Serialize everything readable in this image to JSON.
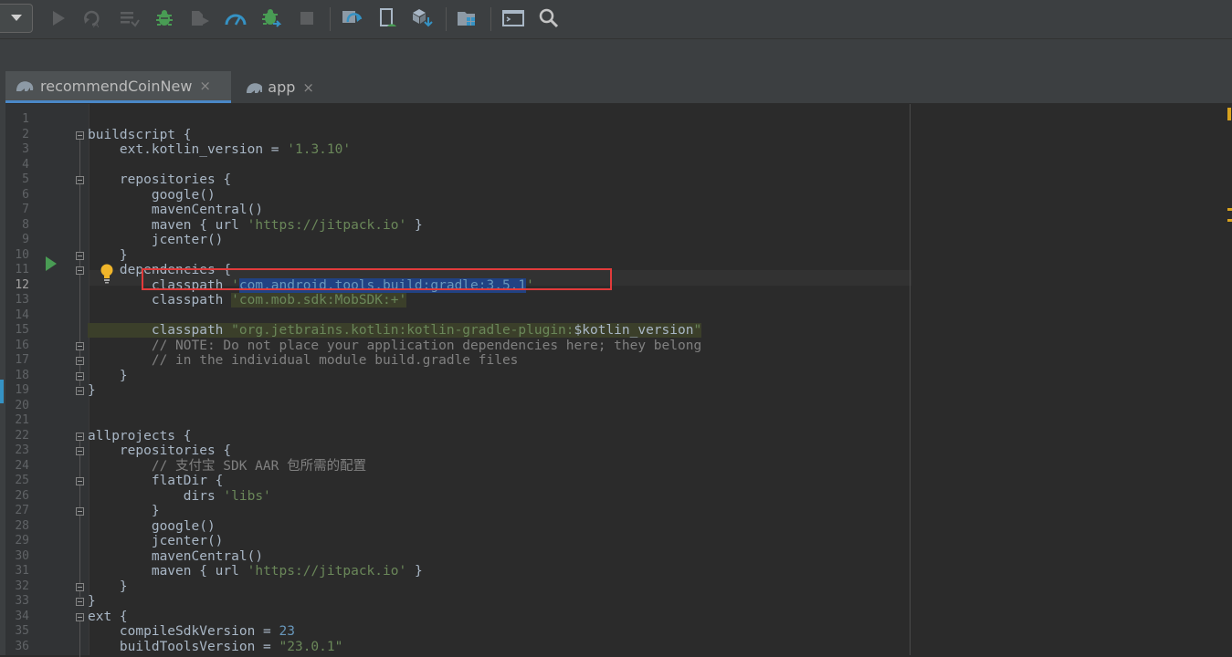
{
  "toolbar": {
    "icons": [
      "config-dropdown-icon",
      "run-icon",
      "apply-changes-icon",
      "coverage-icon",
      "debug-icon",
      "attach-debugger-icon",
      "profile-icon",
      "debug-bug-icon",
      "stop-icon",
      "sync-gradle-icon",
      "avd-manager-icon",
      "sdk-manager-icon",
      "project-structure-icon",
      "terminal-icon",
      "search-icon"
    ]
  },
  "tabs": [
    {
      "label": "recommendCoinNew",
      "active": true
    },
    {
      "label": "app",
      "active": false
    }
  ],
  "tab_close_glyph": "×",
  "editor": {
    "line_numbers": [
      "1",
      "2",
      "3",
      "4",
      "5",
      "6",
      "7",
      "8",
      "9",
      "10",
      "11",
      "12",
      "13",
      "14",
      "15",
      "16",
      "17",
      "18",
      "19",
      "20",
      "21",
      "22",
      "23",
      "24",
      "25",
      "26",
      "27",
      "28",
      "29",
      "30",
      "31",
      "32",
      "33",
      "34",
      "35",
      "36"
    ],
    "lines": [
      {
        "parts": []
      },
      {
        "parts": [
          {
            "t": "buildscript {",
            "c": "p"
          }
        ]
      },
      {
        "parts": [
          {
            "t": "    ext.kotlin_version = ",
            "c": "p"
          },
          {
            "t": "'1.3.10'",
            "c": "s"
          }
        ]
      },
      {
        "parts": []
      },
      {
        "parts": [
          {
            "t": "    repositories {",
            "c": "p"
          }
        ]
      },
      {
        "parts": [
          {
            "t": "        google()",
            "c": "p"
          }
        ]
      },
      {
        "parts": [
          {
            "t": "        mavenCentral()",
            "c": "p"
          }
        ]
      },
      {
        "parts": [
          {
            "t": "        maven { url ",
            "c": "p"
          },
          {
            "t": "'https://jitpack.io'",
            "c": "s"
          },
          {
            "t": " }",
            "c": "p"
          }
        ]
      },
      {
        "parts": [
          {
            "t": "        jcenter()",
            "c": "p"
          }
        ]
      },
      {
        "parts": [
          {
            "t": "    }",
            "c": "p"
          }
        ]
      },
      {
        "parts": [
          {
            "t": "    dependencies {",
            "c": "p"
          }
        ]
      },
      {
        "parts": [
          {
            "t": "        classpath ",
            "c": "p"
          },
          {
            "t": "'",
            "c": "s"
          },
          {
            "t": "com.android.tools.build:gradle:3.5.1",
            "c": "sel"
          },
          {
            "t": "'",
            "c": "s"
          }
        ]
      },
      {
        "parts": [
          {
            "t": "        classpath ",
            "c": "p"
          },
          {
            "t": "'com.mob.sdk:MobSDK:+'",
            "c": "sh"
          }
        ]
      },
      {
        "parts": []
      },
      {
        "parts": [
          {
            "t": "        classpath ",
            "c": "ph"
          },
          {
            "t": "\"org.jetbrains.kotlin:kotlin-gradle-plugin:",
            "c": "sh"
          },
          {
            "t": "$kotlin_version",
            "c": "ph"
          },
          {
            "t": "\"",
            "c": "sh"
          }
        ]
      },
      {
        "parts": [
          {
            "t": "        // NOTE: Do not place your application dependencies here; they belong",
            "c": "m"
          }
        ]
      },
      {
        "parts": [
          {
            "t": "        // in the individual module build.gradle files",
            "c": "m"
          }
        ]
      },
      {
        "parts": [
          {
            "t": "    }",
            "c": "p"
          }
        ]
      },
      {
        "parts": [
          {
            "t": "}",
            "c": "p"
          }
        ]
      },
      {
        "parts": []
      },
      {
        "parts": []
      },
      {
        "parts": [
          {
            "t": "allprojects {",
            "c": "p"
          }
        ]
      },
      {
        "parts": [
          {
            "t": "    repositories {",
            "c": "p"
          }
        ]
      },
      {
        "parts": [
          {
            "t": "        // 支付宝 SDK AAR 包所需的配置",
            "c": "m"
          }
        ]
      },
      {
        "parts": [
          {
            "t": "        flatDir {",
            "c": "p"
          }
        ]
      },
      {
        "parts": [
          {
            "t": "            dirs ",
            "c": "p"
          },
          {
            "t": "'libs'",
            "c": "s"
          }
        ]
      },
      {
        "parts": [
          {
            "t": "        }",
            "c": "p"
          }
        ]
      },
      {
        "parts": [
          {
            "t": "        google()",
            "c": "p"
          }
        ]
      },
      {
        "parts": [
          {
            "t": "        jcenter()",
            "c": "p"
          }
        ]
      },
      {
        "parts": [
          {
            "t": "        mavenCentral()",
            "c": "p"
          }
        ]
      },
      {
        "parts": [
          {
            "t": "        maven { url ",
            "c": "p"
          },
          {
            "t": "'https://jitpack.io'",
            "c": "s"
          },
          {
            "t": " }",
            "c": "p"
          }
        ]
      },
      {
        "parts": [
          {
            "t": "    }",
            "c": "p"
          }
        ]
      },
      {
        "parts": [
          {
            "t": "}",
            "c": "p"
          }
        ]
      },
      {
        "parts": [
          {
            "t": "ext {",
            "c": "p"
          }
        ]
      },
      {
        "parts": [
          {
            "t": "    compileSdkVersion = ",
            "c": "p"
          },
          {
            "t": "23",
            "c": "n"
          }
        ]
      },
      {
        "parts": [
          {
            "t": "    buildToolsVersion = ",
            "c": "p"
          },
          {
            "t": "\"23.0.1\"",
            "c": "s"
          }
        ]
      }
    ],
    "current_line": "12",
    "highlighted_line": "12"
  },
  "colors": {
    "background": "#2b2b2b",
    "plain": "#a9b7c6",
    "string": "#6a8759",
    "number": "#6897bb",
    "comment": "#808080",
    "selection": "#214283",
    "tab_active_underline": "#4a88c7",
    "highlight_box": "#e23b3b",
    "run_icon": "#499c54",
    "bulb": "#f0b52a"
  }
}
